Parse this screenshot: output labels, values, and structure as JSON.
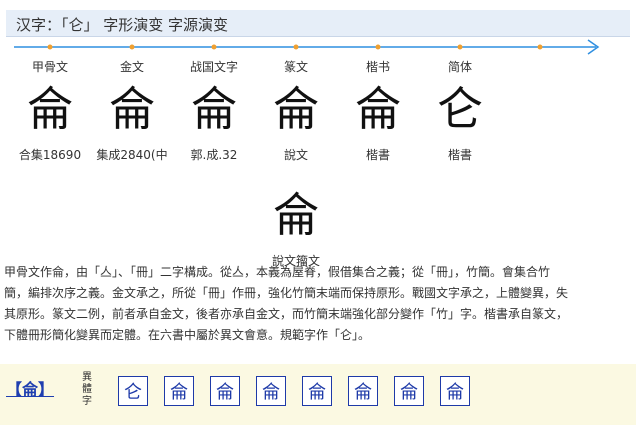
{
  "header": {
    "title": "汉字：「仑」 字形演变 字源演变"
  },
  "stages": [
    {
      "label": "甲骨文",
      "glyph": "侖",
      "source": "合集18690"
    },
    {
      "label": "金文",
      "glyph": "侖",
      "source": "集成2840(中"
    },
    {
      "label": "战国文字",
      "glyph": "侖",
      "source": "郭.成.32"
    },
    {
      "label": "篆文",
      "glyph": "侖",
      "source": "說文"
    },
    {
      "label": "楷书",
      "glyph": "侖",
      "source": "楷書"
    },
    {
      "label": "简体",
      "glyph": "仑",
      "source": "楷書"
    }
  ],
  "extra_glyph": {
    "glyph": "侖",
    "source": "說文籀文"
  },
  "description": {
    "line1_a": "甲骨文作",
    "line1_glyph": "侖",
    "line1_b": "，由「亼」、「冊」二字構成。從亼，本義為屋脊，假借集合之義；從「冊」，竹簡。會集合竹",
    "line2_a": "簡，編排次序之義。金文承之，所從「冊」作",
    "line2_glyph": "冊",
    "line2_b": "，強化竹簡末端而保持原形。戰國文字承之，上體變異，失",
    "line3": "其原形。篆文二例，前者承自金文，後者亦承自金文，而竹簡末端強化部分變作「竹」字。楷書承自篆文，",
    "line4": "下體冊形簡化變異而定體。在六書中屬於異文會意。規範字作「仑」。"
  },
  "variants": {
    "main": "【侖】",
    "label": "異體字",
    "chars": [
      "仑",
      "侖",
      "侖",
      "侖",
      "侖",
      "侖",
      "侖",
      "侖"
    ]
  },
  "colors": {
    "accent": "#2f8fe0",
    "dot": "#f0a030",
    "link": "#1f3fb0",
    "variant_bg": "#fbf9e2"
  }
}
